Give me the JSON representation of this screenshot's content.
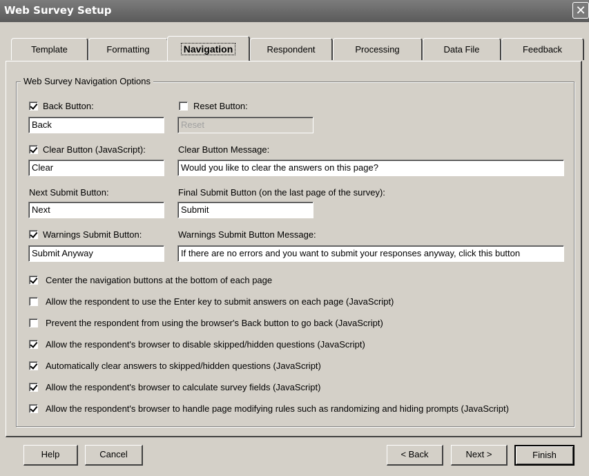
{
  "window": {
    "title": "Web Survey Setup",
    "close_glyph": "✕"
  },
  "tabs": [
    {
      "label": "Template"
    },
    {
      "label": "Formatting"
    },
    {
      "label": "Navigation"
    },
    {
      "label": "Respondent"
    },
    {
      "label": "Processing"
    },
    {
      "label": "Data File"
    },
    {
      "label": "Feedback"
    }
  ],
  "group": {
    "title": "Web Survey Navigation Options"
  },
  "fields": {
    "back_button": {
      "label": "Back Button:",
      "checked": true,
      "value": "Back"
    },
    "reset_button": {
      "label": "Reset Button:",
      "checked": false,
      "value": "Reset"
    },
    "clear_button": {
      "label": "Clear Button (JavaScript):",
      "checked": true,
      "value": "Clear"
    },
    "clear_message": {
      "label": "Clear Button Message:",
      "value": "Would you like to clear the answers on this page?"
    },
    "next_submit": {
      "label": "Next Submit Button:",
      "value": "Next"
    },
    "final_submit": {
      "label": "Final Submit Button (on the last page of the survey):",
      "value": "Submit"
    },
    "warnings_submit": {
      "label": "Warnings Submit Button:",
      "checked": true,
      "value": "Submit Anyway"
    },
    "warnings_message": {
      "label": "Warnings Submit Button Message:",
      "value": "If there are no errors and you want to submit your responses anyway, click this button"
    }
  },
  "options": [
    {
      "label": "Center the navigation buttons at the bottom of each page",
      "checked": true
    },
    {
      "label": "Allow the respondent to use the Enter key to submit answers on each page (JavaScript)",
      "checked": false
    },
    {
      "label": "Prevent the respondent from using the browser's Back button to go back (JavaScript)",
      "checked": false
    },
    {
      "label": "Allow the respondent's browser to disable skipped/hidden questions (JavaScript)",
      "checked": true
    },
    {
      "label": "Automatically clear answers to skipped/hidden questions (JavaScript)",
      "checked": true
    },
    {
      "label": "Allow the respondent's browser to calculate survey fields (JavaScript)",
      "checked": true
    },
    {
      "label": "Allow the respondent's browser to handle page modifying rules such as randomizing and hiding prompts (JavaScript)",
      "checked": true
    }
  ],
  "buttons": {
    "help": "Help",
    "cancel": "Cancel",
    "back": "< Back",
    "next": "Next >",
    "finish": "Finish"
  }
}
